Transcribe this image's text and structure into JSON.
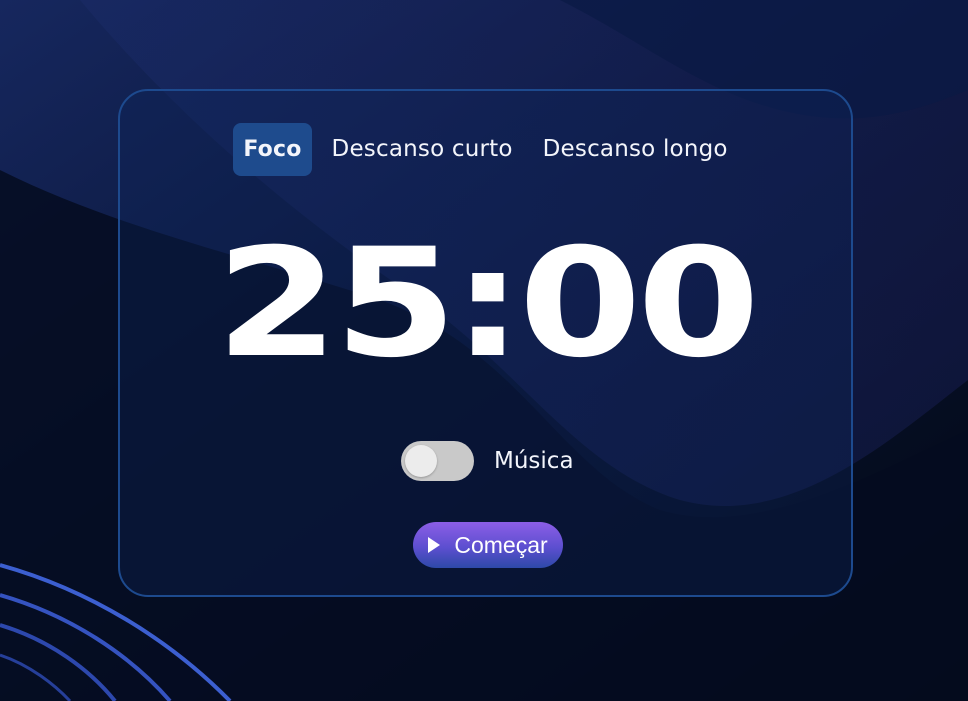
{
  "tabs": [
    {
      "label": "Foco",
      "active": true
    },
    {
      "label": "Descanso curto",
      "active": false
    },
    {
      "label": "Descanso longo",
      "active": false
    }
  ],
  "timer": {
    "display": "25:00"
  },
  "music": {
    "label": "Música",
    "enabled": false
  },
  "start_button": {
    "label": "Começar",
    "icon": "play-icon"
  },
  "colors": {
    "background": "#040b1c",
    "card_border": "#1d4a8e",
    "active_tab": "#1e4b8d",
    "button_top": "#8c5ee6",
    "button_bottom": "#2d49a8",
    "switch_off": "#c9c9c9"
  }
}
